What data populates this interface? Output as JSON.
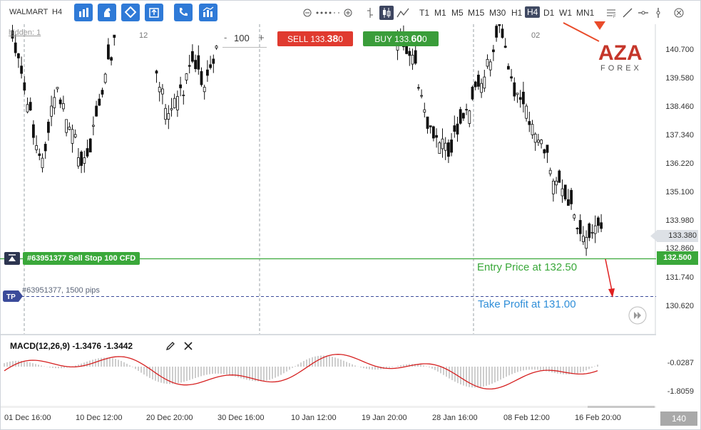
{
  "toolbar": {
    "symbol": "WALMART",
    "timeframe": "H4",
    "timeframes": [
      "T1",
      "M1",
      "M5",
      "M15",
      "M30",
      "H1",
      "H4",
      "D1",
      "W1",
      "MN1"
    ],
    "active_timeframe": "H4",
    "buttons": [
      "bar-chart-icon",
      "horse-icon",
      "diamond-icon",
      "export-icon",
      "phone-icon",
      "indicators-icon"
    ]
  },
  "trade": {
    "quantity": "100",
    "minus": "-",
    "plus": "+",
    "sell_label": "SELL",
    "sell_price_main": "133.",
    "sell_price_big": "38",
    "sell_price_tail": "0",
    "buy_label": "BUY",
    "buy_price_main": "133.",
    "buy_price_big": "60",
    "buy_price_tail": "0"
  },
  "chart": {
    "hidden_label": "hidden: 1",
    "date_markers": [
      "12",
      "02"
    ],
    "y_axis_labels": [
      "140.700",
      "139.580",
      "138.460",
      "137.340",
      "136.220",
      "135.100",
      "133.980",
      "133.380",
      "132.860",
      "131.740",
      "130.620"
    ],
    "current_price": "133.380",
    "order_tag": "#63951377 Sell Stop 100 CFD",
    "entry_price_tag": "132.500",
    "tp_badge": "TP",
    "tp_info": "#63951377, 1500 pips",
    "entry_note": "Entry Price at 132.50",
    "tp_note": "Take Profit at 131.00",
    "watermark_brand": "AZA",
    "watermark_sub": "FOREX"
  },
  "macd": {
    "label": "MACD(12,26,9) -1.3476 -1.3442",
    "y_axis_labels": [
      "-0.0287",
      "-1.8059"
    ]
  },
  "x_axis_labels": [
    "01 Dec 16:00",
    "10 Dec 12:00",
    "20 Dec 20:00",
    "30 Dec 16:00",
    "10 Jan 12:00",
    "19 Jan 20:00",
    "28 Jan 16:00",
    "08 Feb 12:00",
    "16 Feb 20:00"
  ],
  "page_count": "140",
  "colors": {
    "sell": "#e03a2f",
    "buy": "#3a9d3a",
    "entry_line": "#3aa83a",
    "tp_line": "#3b4b9a",
    "macd_signal": "#d62020"
  }
}
